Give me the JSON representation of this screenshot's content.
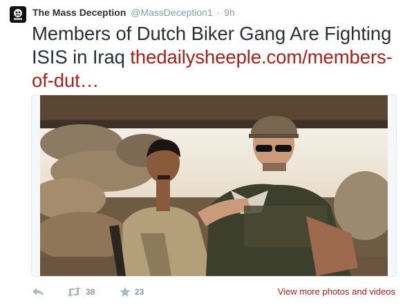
{
  "tweet": {
    "author_name": "The Mass Deception",
    "handle": "@MassDeception1",
    "separator": "·",
    "time": "9h",
    "text": "Members of Dutch Biker Gang Are Fighting ISIS in Iraq",
    "link_text": "thedailysheeple.com/members-of-dut…"
  },
  "media": {
    "description": "photo"
  },
  "actions": {
    "reply_icon": "reply-icon",
    "retweet_icon": "retweet-icon",
    "retweet_count": "38",
    "favorite_icon": "star-icon",
    "favorite_count": "23",
    "more_link": "View more photos and videos"
  },
  "colors": {
    "link": "#a8211b",
    "muted": "#8899a6",
    "text": "#292f33"
  }
}
